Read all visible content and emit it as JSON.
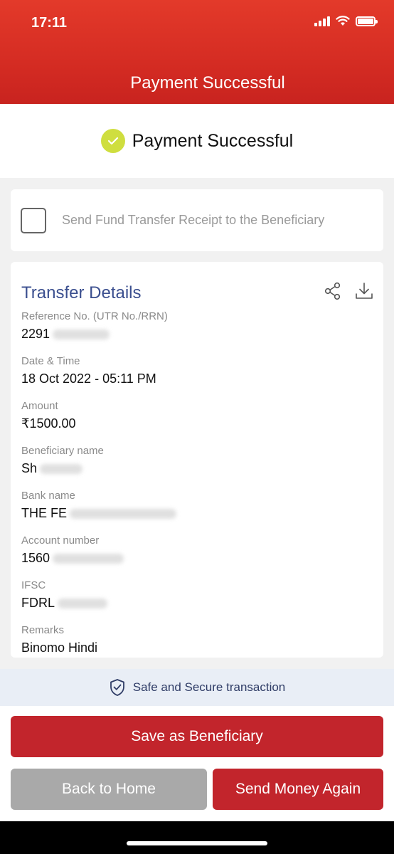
{
  "status_bar": {
    "time": "17:11"
  },
  "header": {
    "title": "Payment Successful"
  },
  "success": {
    "text": "Payment Successful"
  },
  "receipt": {
    "label": "Send Fund Transfer Receipt to the Beneficiary",
    "checked": false
  },
  "transfer_details": {
    "title": "Transfer Details",
    "fields": [
      {
        "label": "Reference No. (UTR No./RRN)",
        "value": "2291"
      },
      {
        "label": "Date & Time",
        "value": "18 Oct 2022 - 05:11 PM"
      },
      {
        "label": "Amount",
        "value": "₹1500.00"
      },
      {
        "label": "Beneficiary name",
        "value": "Sh"
      },
      {
        "label": "Bank name",
        "value": "THE FE"
      },
      {
        "label": "Account number",
        "value": "1560"
      },
      {
        "label": "IFSC",
        "value": "FDRL"
      },
      {
        "label": "Remarks",
        "value": "Binomo Hindi"
      }
    ]
  },
  "secure": {
    "text": "Safe and Secure transaction"
  },
  "buttons": {
    "save_beneficiary": "Save as Beneficiary",
    "back_home": "Back to Home",
    "send_again": "Send Money Again"
  },
  "colors": {
    "brand_red": "#c2252c",
    "header_red": "#d52c23",
    "title_blue": "#3b4f8f",
    "check_green": "#cfde3f"
  },
  "icons": [
    "wifi-icon",
    "signal-icon",
    "battery-icon",
    "check-icon",
    "share-icon",
    "download-icon",
    "shield-check-icon"
  ]
}
